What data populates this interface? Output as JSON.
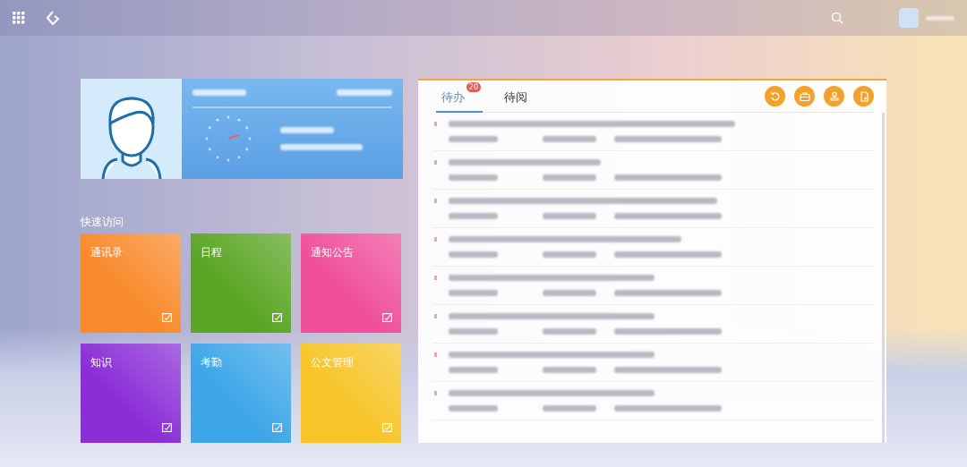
{
  "quick_access": {
    "title": "快速访问",
    "tiles": [
      {
        "label": "通讯录",
        "color": "#f98a2c"
      },
      {
        "label": "日程",
        "color": "#5aa624"
      },
      {
        "label": "通知公告",
        "color": "#f04f9a"
      },
      {
        "label": "知识",
        "color": "#8a2fd6"
      },
      {
        "label": "考勤",
        "color": "#3da6e8"
      },
      {
        "label": "公文管理",
        "color": "#f7c52a"
      }
    ]
  },
  "tasks": {
    "tabs": [
      {
        "label": "待办",
        "selected": true,
        "badge": "20"
      },
      {
        "label": "待阅",
        "selected": false
      }
    ]
  }
}
